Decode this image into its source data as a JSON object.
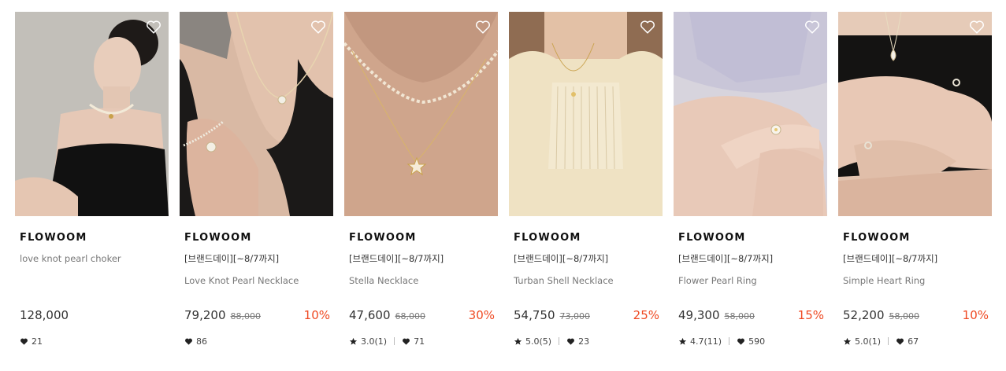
{
  "products": [
    {
      "brand": "FLOWOOM",
      "promo": "",
      "name": "love knot pearl choker",
      "price": "128,000",
      "original_price": "",
      "discount": "",
      "rating": "",
      "likes": "21",
      "photo": "portrait-black-dress"
    },
    {
      "brand": "FLOWOOM",
      "promo": "[브랜드데이][~8/7까지]",
      "name": "Love Knot Pearl Necklace",
      "price": "79,200",
      "original_price": "88,000",
      "discount": "10%",
      "rating": "",
      "likes": "86",
      "photo": "pearl-necklace-bracelet"
    },
    {
      "brand": "FLOWOOM",
      "promo": "[브랜드데이][~8/7까지]",
      "name": "Stella Necklace",
      "price": "47,600",
      "original_price": "68,000",
      "discount": "30%",
      "rating": "3.0(1)",
      "likes": "71",
      "photo": "star-necklace"
    },
    {
      "brand": "FLOWOOM",
      "promo": "[브랜드데이][~8/7까지]",
      "name": "Turban Shell Necklace",
      "price": "54,750",
      "original_price": "73,000",
      "discount": "25%",
      "rating": "5.0(5)",
      "likes": "23",
      "photo": "cream-blouse"
    },
    {
      "brand": "FLOWOOM",
      "promo": "[브랜드데이][~8/7까지]",
      "name": "Flower Pearl Ring",
      "price": "49,300",
      "original_price": "58,000",
      "discount": "15%",
      "rating": "4.7(11)",
      "likes": "590",
      "photo": "flower-ring-hands"
    },
    {
      "brand": "FLOWOOM",
      "promo": "[브랜드데이][~8/7까지]",
      "name": "Simple Heart Ring",
      "price": "52,200",
      "original_price": "58,000",
      "discount": "10%",
      "rating": "5.0(1)",
      "likes": "67",
      "photo": "heart-ring-hands"
    }
  ],
  "colors": {
    "discount": "#ef4a23",
    "text": "#222222",
    "muted": "#777777"
  },
  "icons": {
    "wishlist": "heart-outline-icon",
    "rating": "star-icon",
    "likes": "heart-filled-icon"
  }
}
